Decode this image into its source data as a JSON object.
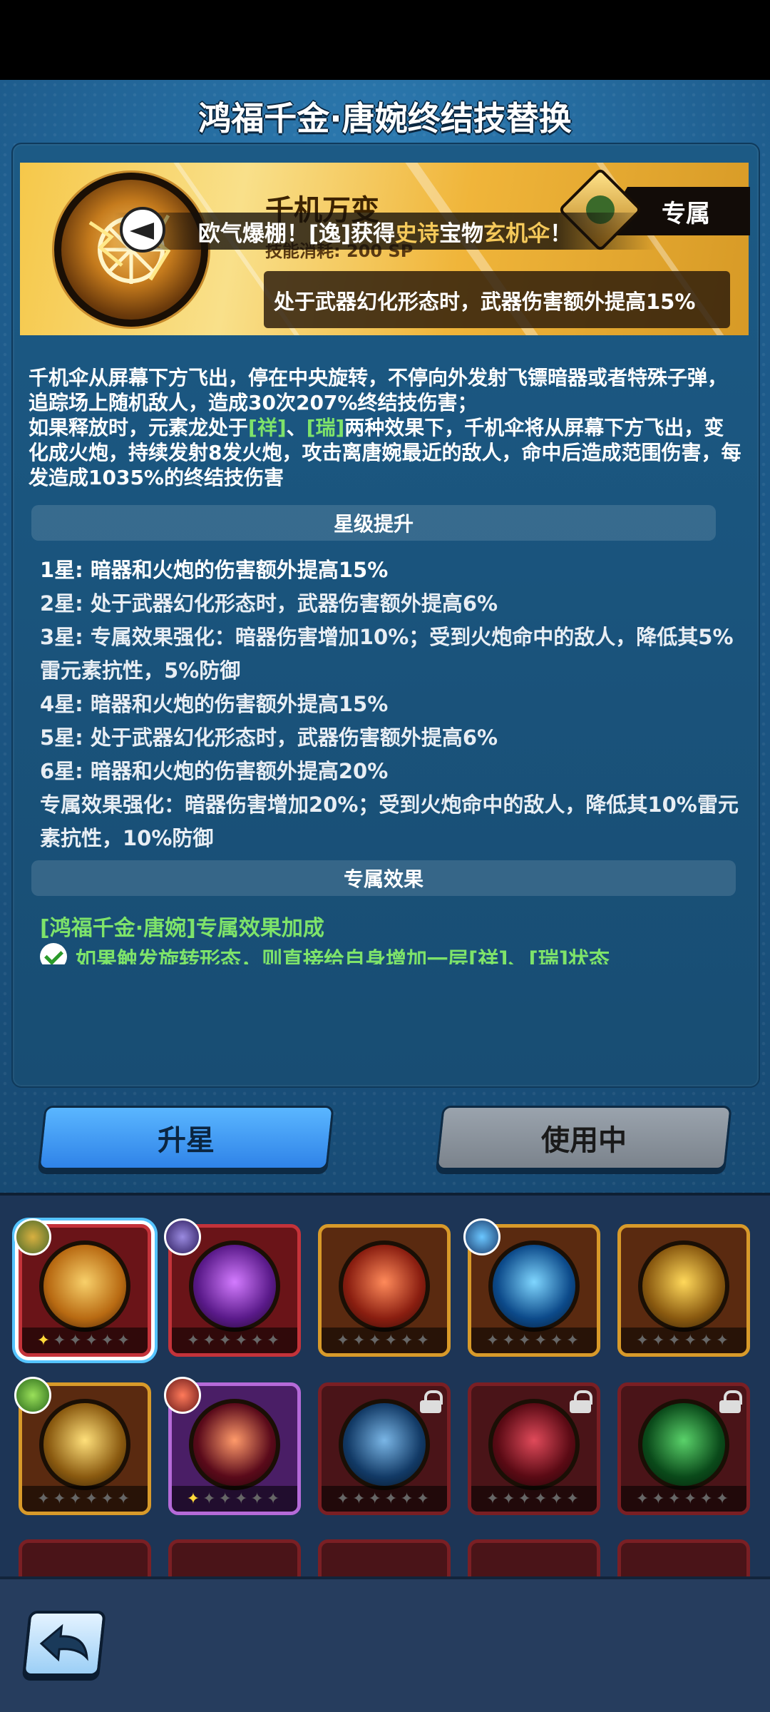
{
  "header": {
    "title": "鸿福千金·唐婉终结技替换"
  },
  "skill": {
    "name": "千机万变",
    "sp_cost": "技能消耗: 200 SP",
    "exclusive_label": "专属",
    "effect": "处于武器幻化形态时，武器伤害额外提高15%"
  },
  "toast": {
    "prefix": "欧气爆棚！[逸]获得",
    "quality": "史诗",
    "middle": "宝物",
    "item": "玄机伞",
    "suffix": "！"
  },
  "description": {
    "p1": "千机伞从屏幕下方飞出，停在中央旋转，不停向外发射飞镖暗器或者特殊子弹，追踪场上随机敌人，造成30次207%终结技伤害；",
    "p2_a": "如果释放时，元素龙处于",
    "p2_tag1": "[祥]",
    "p2_sep": "、",
    "p2_tag2": "[瑞]",
    "p2_b": "两种效果下，千机伞将从屏幕下方飞出，变化成火炮，持续发射8发火炮，攻击离唐婉最近的敌人，命中后造成范围伤害，每发造成1035%的终结技伤害"
  },
  "star_section": {
    "title": "星级提升",
    "lines": [
      "1星: 暗器和火炮的伤害额外提高15%",
      "2星: 处于武器幻化形态时，武器伤害额外提高6%",
      "3星: 专属效果强化：暗器伤害增加10%；受到火炮命中的敌人，降低其5%雷元素抗性，5%防御",
      "4星: 暗器和火炮的伤害额外提高15%",
      "5星: 处于武器幻化形态时，武器伤害额外提高6%",
      "6星: 暗器和火炮的伤害额外提高20%",
      "专属效果强化：暗器伤害增加20%；受到火炮命中的敌人，降低其10%雷元素抗性，10%防御"
    ]
  },
  "exclusive_section": {
    "title": "专属效果",
    "bonus_title": "[鸿福千金·唐婉]专属效果加成",
    "bonus_line": "如果触发旋转形态，则直接给自身增加一层[祥]、[瑞]状态"
  },
  "buttons": {
    "upgrade": "升星",
    "in_use": "使用中"
  },
  "cards_row1": [
    {
      "icon": "umbrella-lightning",
      "colors": [
        "#f8d06a",
        "#b86a12"
      ]
    },
    {
      "icon": "purple-flame",
      "colors": [
        "#d37bff",
        "#5a1a8a"
      ]
    },
    {
      "icon": "fire-meteor",
      "colors": [
        "#ff8a5a",
        "#8a1e10"
      ]
    },
    {
      "icon": "ice-crystal",
      "colors": [
        "#7fd6ff",
        "#0c4a8a"
      ]
    },
    {
      "icon": "gold-lightning",
      "colors": [
        "#ffd85a",
        "#8a5a10"
      ]
    }
  ],
  "cards_row2": [
    {
      "icon": "lightning-bolts",
      "colors": [
        "#ffe07a",
        "#8a5a10"
      ]
    },
    {
      "icon": "spirit-flame",
      "colors": [
        "#ff9a6a",
        "#5a0a1a"
      ]
    },
    {
      "icon": "water-slash",
      "colors": [
        "#7ab6e6",
        "#123a66"
      ]
    },
    {
      "icon": "red-totem",
      "colors": [
        "#e04a5a",
        "#5a0a14"
      ]
    },
    {
      "icon": "green-dragon",
      "colors": [
        "#5ad26a",
        "#0a4a1a"
      ]
    }
  ]
}
